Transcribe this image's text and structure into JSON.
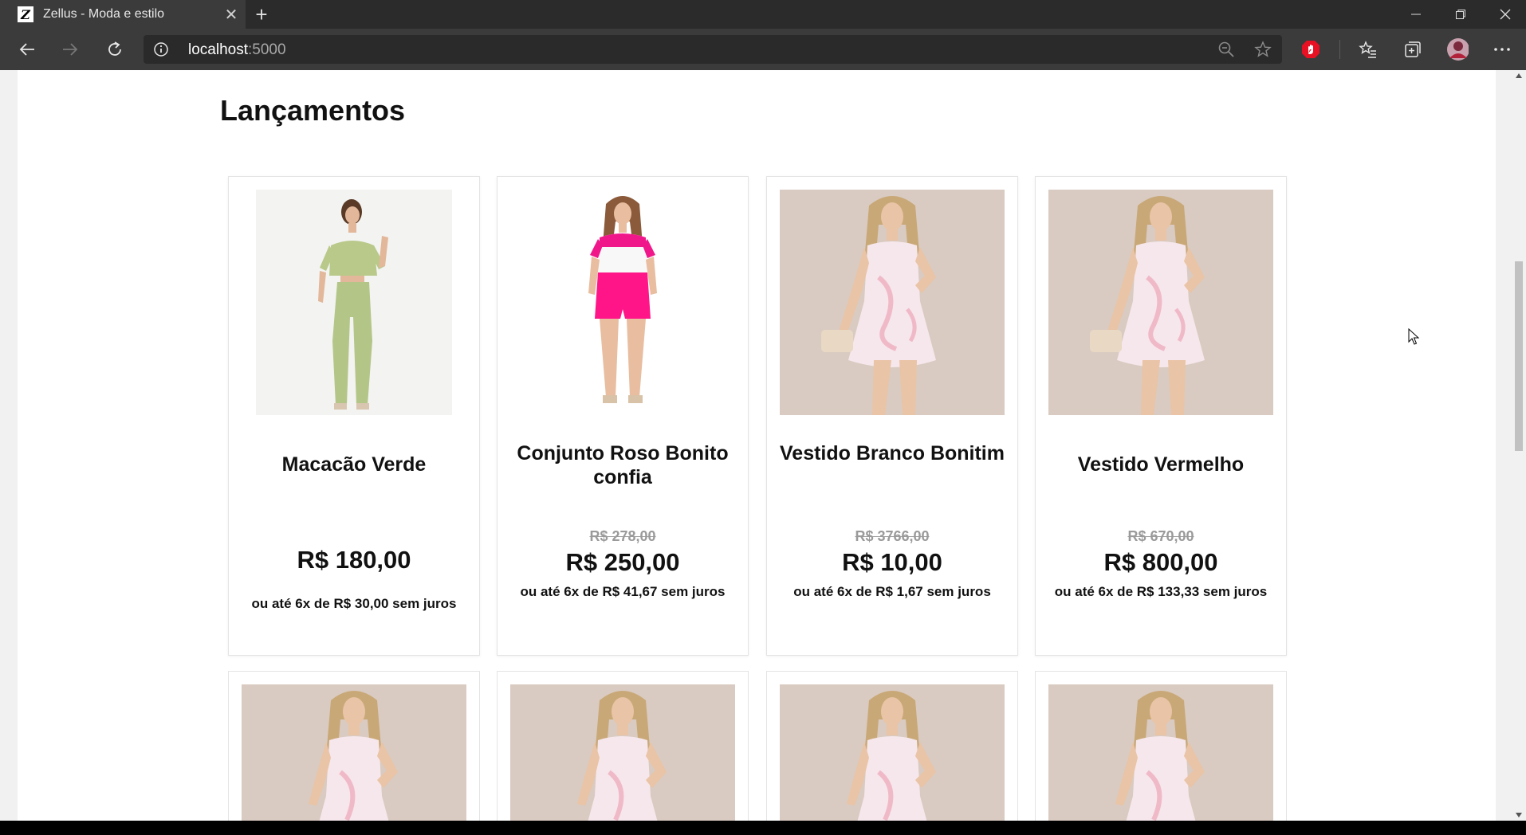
{
  "browser": {
    "tab_title": "Zellus - Moda e estilo",
    "favicon_letter": "Z",
    "url_host": "localhost",
    "url_port": ":5000"
  },
  "page": {
    "section_title": "Lançamentos"
  },
  "products": [
    {
      "name": "Macacão Verde",
      "old_price": "",
      "price": "R$ 180,00",
      "installments": "ou até 6x de R$ 30,00 sem juros",
      "image": "model-green-jumpsuit"
    },
    {
      "name": "Conjunto Roso Bonito confia",
      "old_price": "R$ 278,00",
      "price": "R$ 250,00",
      "installments": "ou até 6x de R$ 41,67 sem juros",
      "image": "model-pink-shorts"
    },
    {
      "name": "Vestido Branco Bonitim",
      "old_price": "R$ 3766,00",
      "price": "R$ 10,00",
      "installments": "ou até 6x de R$ 1,67 sem juros",
      "image": "model-white-dress"
    },
    {
      "name": "Vestido Vermelho",
      "old_price": "R$ 670,00",
      "price": "R$ 800,00",
      "installments": "ou até 6x de R$ 133,33 sem juros",
      "image": "model-white-dress"
    }
  ],
  "colors": {
    "chrome_dark": "#2b2b2b",
    "chrome_toolbar": "#3b3b3b",
    "old_price": "#9a9a9a",
    "extension_red": "#e81123"
  }
}
